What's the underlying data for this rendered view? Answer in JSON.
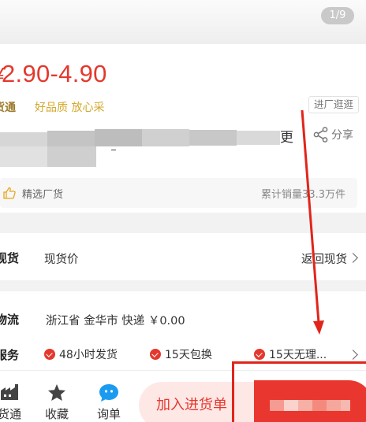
{
  "banner": {
    "page_indicator": "1/9"
  },
  "product": {
    "price_symbol": "¥",
    "price": "2.90-4.90",
    "brand": "货通",
    "slogan": "好品质 放心采",
    "factory_tag": "进厂逛逛",
    "title_visible_char": "更",
    "share_label": "分享"
  },
  "feature": {
    "label": "精选厂货",
    "sold": "累计销量33.3万件"
  },
  "stock": {
    "title": "现货",
    "value": "现货价",
    "link": "返回现货"
  },
  "logistics": {
    "title": "物流",
    "value": "浙江省 金华市  快递 ￥0.00"
  },
  "service": {
    "title": "服务",
    "items": [
      "48小时发货",
      "15天包换",
      "15天无理..."
    ]
  },
  "bottom_nav": {
    "items": [
      {
        "label": "货通",
        "icon": "factory-icon"
      },
      {
        "label": "收藏",
        "icon": "star-icon"
      },
      {
        "label": "询单",
        "icon": "chat-icon"
      }
    ],
    "add_to_cart": "加入进货单",
    "buy_now": ""
  },
  "colors": {
    "accent": "#e5382d",
    "gold": "#d4a82b",
    "annotation": "#e1251b"
  }
}
